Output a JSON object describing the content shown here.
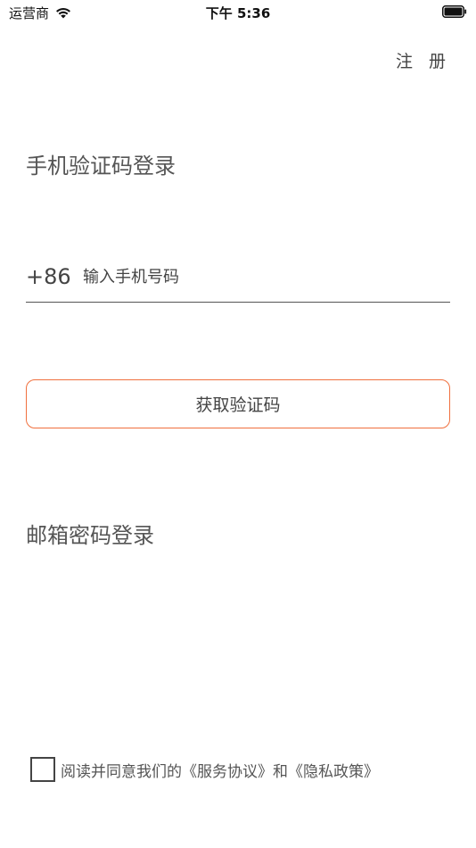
{
  "status_bar": {
    "carrier": "运营商",
    "time": "下午 5:36",
    "wifi_icon": "wifi-icon",
    "battery_icon": "battery-icon"
  },
  "header": {
    "register_label": "注 册"
  },
  "phone_login": {
    "title": "手机验证码登录",
    "country_code": "+86",
    "phone_placeholder": "输入手机号码",
    "phone_value": "",
    "get_code_label": "获取验证码"
  },
  "email_login": {
    "title": "邮箱密码登录"
  },
  "agreement": {
    "checked": false,
    "prefix": "阅读并同意我们的",
    "service_link": "《服务协议》",
    "conjunction": "和",
    "privacy_link": "《隐私政策》"
  },
  "colors": {
    "accent": "#f0703e",
    "text": "#444444",
    "background": "#ffffff"
  }
}
